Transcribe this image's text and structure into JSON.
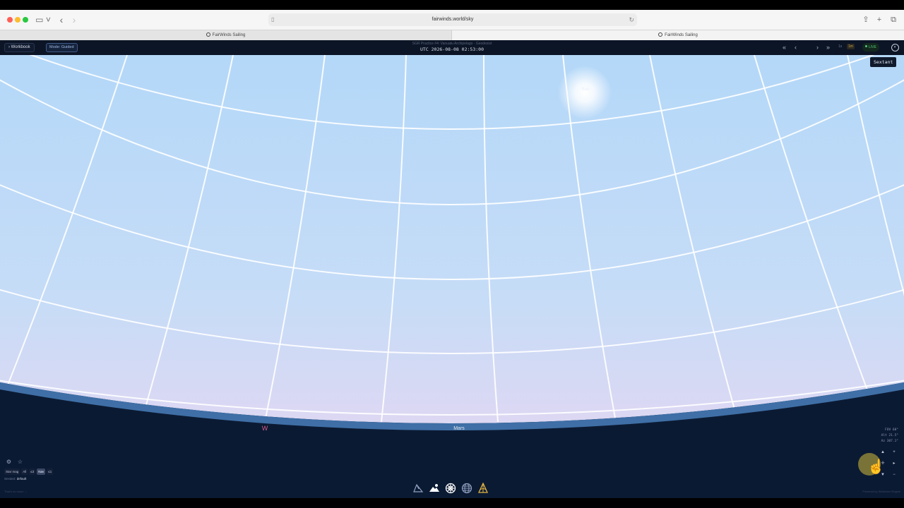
{
  "browser": {
    "url": "fairwinds.world/sky",
    "tabs": [
      {
        "label": "FairWinds Sailing"
      },
      {
        "label": "FairWinds Sailing"
      }
    ]
  },
  "appbar": {
    "workbook_label": "Workbook",
    "mode_label": "Mode: Guided",
    "session_title": "SGR Practice #4: Vanuatu Archipelago · Geodesist",
    "utc_clock": "UTC 2026-08-08 02:53:00",
    "speed_options": [
      "1s",
      "1m"
    ],
    "live_label": "LIVE"
  },
  "sky": {
    "sextant_label": "Sextant",
    "sun_label": "Sun",
    "horizon_labels": {
      "west": "W",
      "planet": "Mars"
    },
    "colors": {
      "sky_top": "#b9dbf9",
      "sky_bottom": "#e9d6f1",
      "ground": "#0b1a33",
      "horizon_band": "#3f6fa6",
      "grid": "#ffffff",
      "west_marker": "#d65d8a"
    }
  },
  "hud": {
    "star_mag_chips": [
      "Star mag",
      "All",
      "≤3",
      "Nav",
      "≤1"
    ],
    "active_chip": "Nav",
    "sextant_status_label": "Sextant:",
    "sextant_status_value": "default",
    "hint": "That's no moon →",
    "powered_by": "Powered by Stellarium Engine",
    "fov_lines": [
      "FOV 60°",
      "Alt 21.5°",
      "Az 307.1°"
    ]
  },
  "toolbar": {
    "tools": [
      "constellations-icon",
      "clouds-icon",
      "grid-icon",
      "globe-icon",
      "sextant-icon"
    ]
  }
}
